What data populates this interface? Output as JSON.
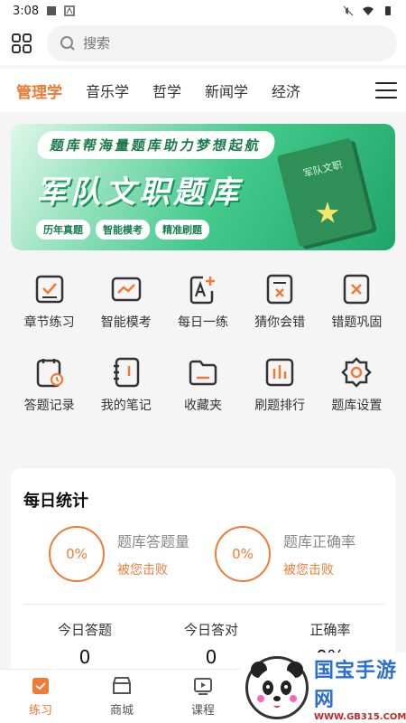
{
  "status_bar": {
    "time": "3:08"
  },
  "search": {
    "placeholder": "搜索"
  },
  "tabs": [
    {
      "label": "管理学",
      "active": true
    },
    {
      "label": "音乐学"
    },
    {
      "label": "哲学"
    },
    {
      "label": "新闻学"
    },
    {
      "label": "经济"
    }
  ],
  "banner": {
    "subtitle": "题库帮海量题库助力梦想起航",
    "title": "军队文职题库",
    "chips": [
      "历年真题",
      "智能模考",
      "精准刷题"
    ],
    "book_label": "军队文职"
  },
  "menu": {
    "row1": [
      "章节练习",
      "智能模考",
      "每日一练",
      "猜你会错",
      "错题巩固"
    ],
    "row2": [
      "答题记录",
      "我的笔记",
      "收藏夹",
      "刷题排行",
      "题库设置"
    ]
  },
  "stats": {
    "heading": "每日统计",
    "left_ring": "0%",
    "left_title": "题库答题量",
    "left_sub": "被您击败",
    "right_ring": "0%",
    "right_title": "题库正确率",
    "right_sub": "被您击败",
    "today": [
      {
        "label": "今日答题",
        "value": "0"
      },
      {
        "label": "今日答对",
        "value": "0"
      },
      {
        "label": "正确率",
        "value": "0%"
      }
    ]
  },
  "bottom_nav": [
    {
      "label": "练习",
      "active": true
    },
    {
      "label": "商城"
    },
    {
      "label": "课程"
    }
  ],
  "watermark": {
    "brand": "国宝手游网",
    "url": "WWW.GB315.COM"
  },
  "colors": {
    "accent": "#f07a36",
    "banner_green": "#2fb872"
  }
}
